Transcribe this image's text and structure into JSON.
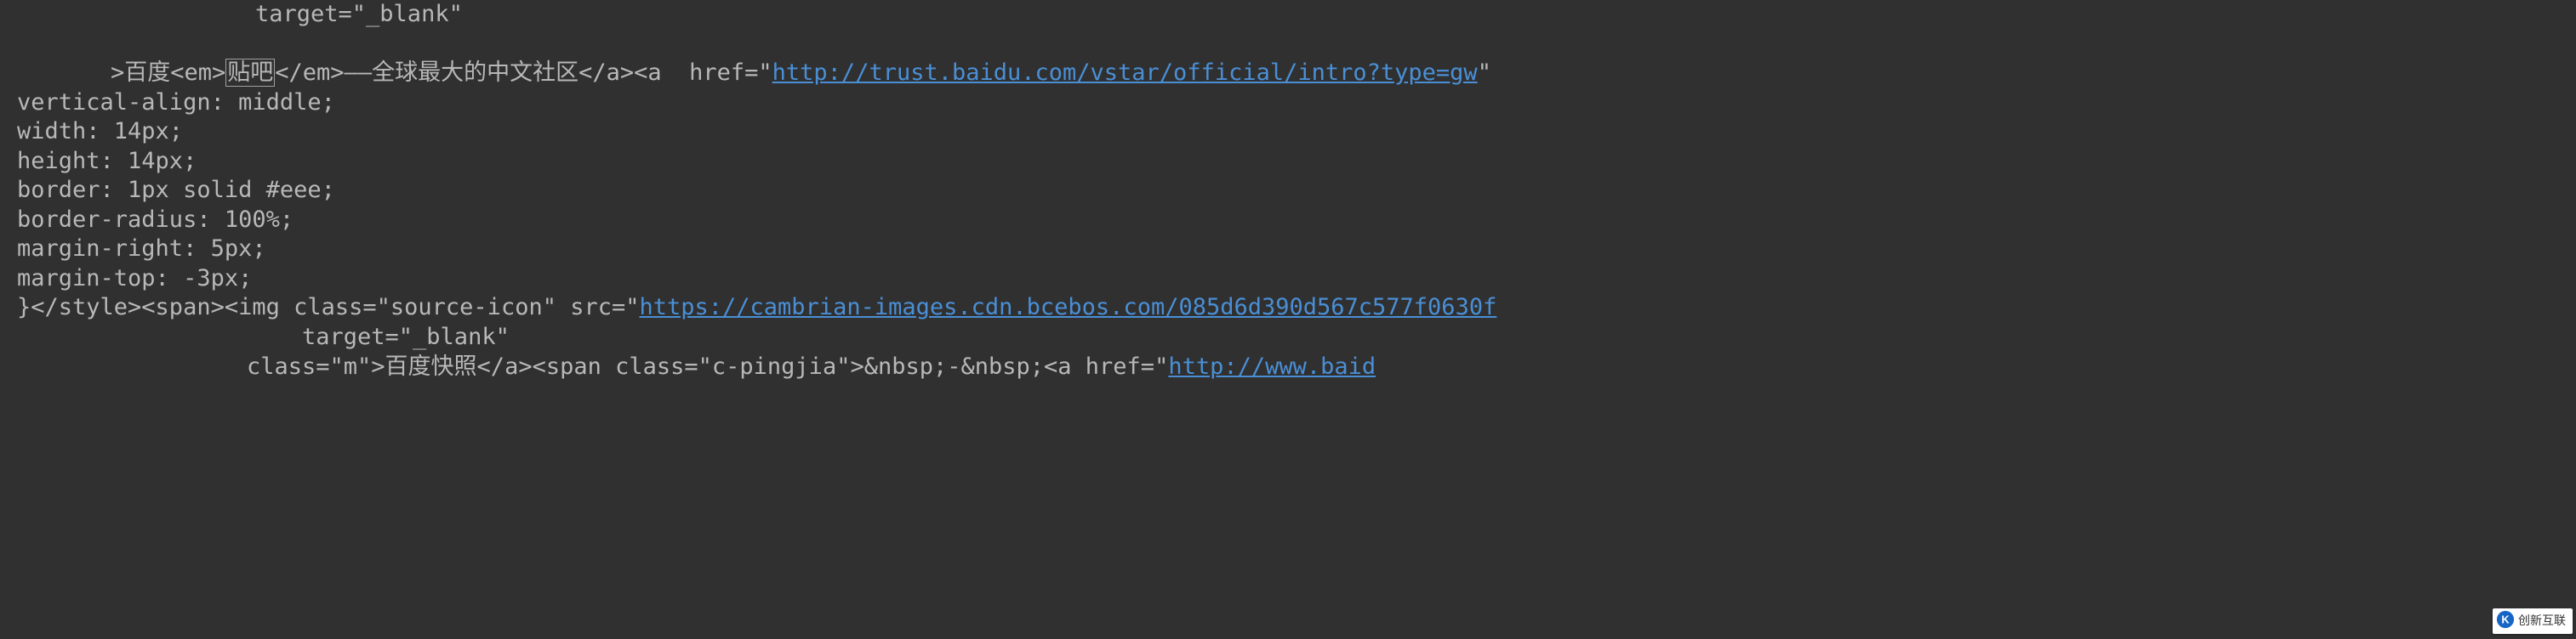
{
  "code": {
    "line1_indent": "target=\"_blank\"",
    "line2_prefix": ">百度<em>",
    "line2_highlighted": "贴吧",
    "line2_after_highlight": "</em>——全球最大的中文社区</a><a  href=\"",
    "line2_url": "http://trust.baidu.com/vstar/official/intro?type=gw",
    "line2_suffix": "\"",
    "line3": "vertical-align: middle;",
    "line4": "width: 14px;",
    "line5": "height: 14px;",
    "line6": "border: 1px solid #eee;",
    "line7": "border-radius: 100%;",
    "line8": "margin-right: 5px;",
    "line9": "margin-top: -3px;",
    "line10_prefix": "}</style><span><img class=\"source-icon\" src=\"",
    "line10_url": "https://cambrian-images.cdn.bcebos.com/085d6d390d567c577f0630f",
    "line11_indent": "target=\"_blank\"",
    "line12_prefix": "class=\"m\">百度快照</a><span class=\"c-pingjia\">&nbsp;-&nbsp;<a href=\"",
    "line12_url": "http://www.baid"
  },
  "watermark": {
    "text": "创新互联"
  }
}
